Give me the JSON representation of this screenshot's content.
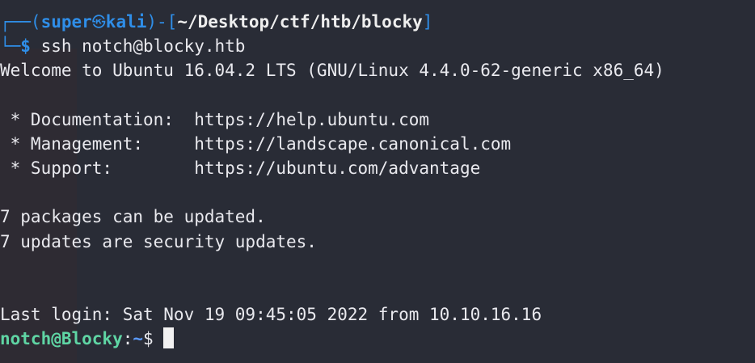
{
  "prompt": {
    "user": "super",
    "host": "kali",
    "cwd": "~/Desktop/ctf/htb/blocky",
    "command": "ssh notch@blocky.htb",
    "skull_icon": "kali-skull-icon"
  },
  "output": {
    "welcome": "Welcome to Ubuntu 16.04.2 LTS (GNU/Linux 4.4.0-62-generic x86_64)",
    "links": [
      {
        "label": " * Documentation:  ",
        "url": "https://help.ubuntu.com"
      },
      {
        "label": " * Management:     ",
        "url": "https://landscape.canonical.com"
      },
      {
        "label": " * Support:        ",
        "url": "https://ubuntu.com/advantage"
      }
    ],
    "updates_1": "7 packages can be updated.",
    "updates_2": "7 updates are security updates.",
    "last_login": "Last login: Sat Nov 19 09:45:05 2022 from 10.10.16.16"
  },
  "remote_prompt": {
    "user_host": "notch@Blocky",
    "sep": ":",
    "path": "~",
    "symbol": "$ "
  },
  "colors": {
    "background": "#292c36",
    "prompt_blue": "#2f8ee8",
    "remote_user_green": "#5fd5a4",
    "text": "#e9e9ee"
  }
}
